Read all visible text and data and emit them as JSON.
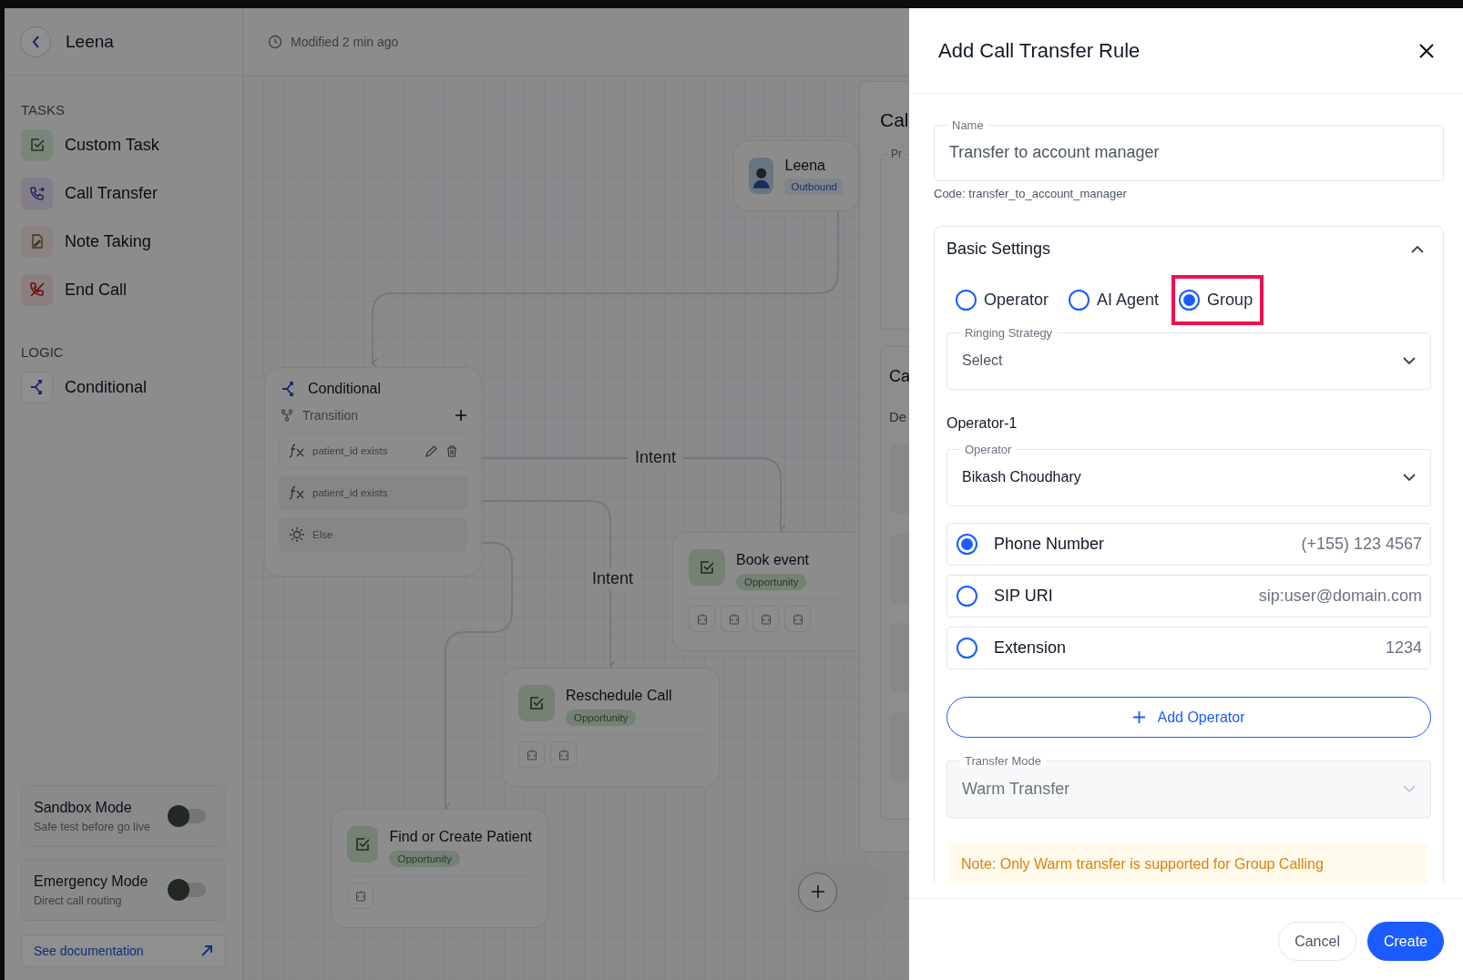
{
  "header": {
    "title": "Leena",
    "modified": "Modified 2 min ago"
  },
  "sidebar": {
    "sections": [
      {
        "heading": "TASKS",
        "items": [
          {
            "label": "Custom Task",
            "kind": "task"
          },
          {
            "label": "Call Transfer",
            "kind": "transfer"
          },
          {
            "label": "Note Taking",
            "kind": "note"
          },
          {
            "label": "End Call",
            "kind": "end"
          }
        ]
      },
      {
        "heading": "LOGIC",
        "items": [
          {
            "label": "Conditional",
            "kind": "conditional"
          }
        ]
      }
    ],
    "modes": [
      {
        "title": "Sandbox Mode",
        "subtitle": "Safe test before go live",
        "on": false
      },
      {
        "title": "Emergency Mode",
        "subtitle": "Direct call routing",
        "on": false
      }
    ],
    "doc_link": "See documentation"
  },
  "canvas": {
    "agent": {
      "name": "Leena",
      "badge": "Outbound"
    },
    "conditional": {
      "title": "Conditional",
      "transition": "Transition",
      "rules": [
        {
          "kind": "expr",
          "text": "patient_id exists",
          "selected": true
        },
        {
          "kind": "expr",
          "text": "patient_id exists",
          "selected": false
        },
        {
          "kind": "else",
          "text": "Else",
          "selected": false
        }
      ]
    },
    "edge_labels": [
      "Intent",
      "Intent"
    ],
    "tasks": [
      {
        "title": "Book event",
        "tag": "Opportunity",
        "tools": [
          {
            "kind": "code"
          },
          {
            "kind": "code"
          },
          {
            "kind": "code"
          },
          {
            "kind": "code"
          }
        ]
      },
      {
        "title": "Reschedule Call",
        "tag": "Opportunity",
        "tools": [
          {
            "kind": "code"
          },
          {
            "kind": "code"
          }
        ]
      },
      {
        "title": "Find or Create Patient",
        "tag": "Opportunity",
        "tools": [
          {
            "kind": "code"
          }
        ]
      }
    ],
    "side_panel": {
      "title": "Cal",
      "field_label": "Pr",
      "card_title": "Ca",
      "card_text": "De"
    }
  },
  "drawer": {
    "title": "Add Call Transfer Rule",
    "name_field": {
      "label": "Name",
      "value": "Transfer to account manager"
    },
    "code": "Code: transfer_to_account_manager",
    "basic_settings": {
      "title": "Basic Settings",
      "expanded": true,
      "targets": [
        {
          "label": "Operator",
          "selected": false,
          "highlighted": false
        },
        {
          "label": "AI Agent",
          "selected": false,
          "highlighted": false
        },
        {
          "label": "Group",
          "selected": true,
          "highlighted": true
        }
      ],
      "ringing": {
        "label": "Ringing Strategy",
        "placeholder": "Select"
      },
      "operators": [
        {
          "heading": "Operator-1",
          "field": {
            "label": "Operator",
            "value": "Bikash Choudhary"
          },
          "destinations": [
            {
              "label": "Phone Number",
              "value": "(+155) 123 4567",
              "selected": true
            },
            {
              "label": "SIP URI",
              "value": "sip:user@domain.com",
              "selected": false
            },
            {
              "label": "Extension",
              "value": "1234",
              "selected": false
            }
          ]
        }
      ],
      "add_button": "Add Operator",
      "transfer_mode": {
        "label": "Transfer Mode",
        "value": "Warm Transfer",
        "disabled": true
      },
      "note": "Note: Only Warm transfer is supported for Group Calling"
    },
    "buttons": [
      {
        "label": "Cancel",
        "kind": "secondary"
      },
      {
        "label": "Create",
        "kind": "primary"
      }
    ]
  }
}
